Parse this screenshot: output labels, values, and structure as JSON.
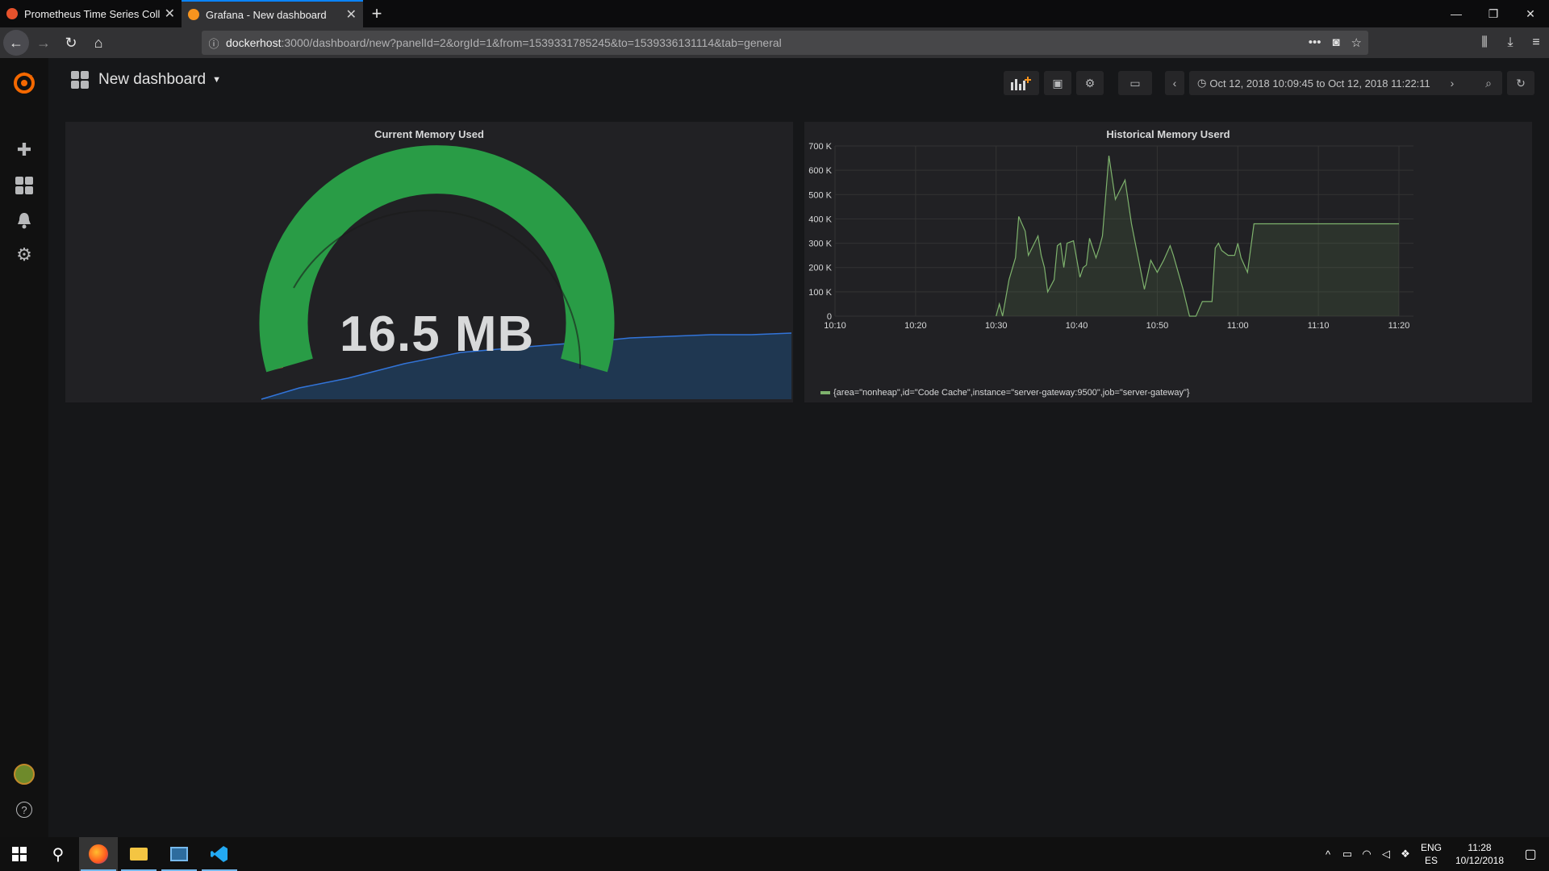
{
  "browser": {
    "tabs": [
      {
        "title": "Prometheus Time Series Collec",
        "color": "#e6522c",
        "active": false
      },
      {
        "title": "Grafana - New dashboard",
        "color": "#f7941e",
        "active": true
      }
    ],
    "url_host": "dockerhost",
    "url_path": ":3000/dashboard/new?panelId=2&orgId=1&from=1539331785245&to=1539336131114&tab=general"
  },
  "grafana": {
    "dashboard_title": "New dashboard",
    "time_range": "Oct 12, 2018 10:09:45 to Oct 12, 2018 11:22:11",
    "side_menu": [
      "grafana-logo",
      "create",
      "dashboards",
      "alerting",
      "configuration",
      "profile",
      "help"
    ]
  },
  "gauge_panel": {
    "title": "Current Memory Used",
    "value_text": "16.5 MB",
    "colors": {
      "ok": "#299c46",
      "critical": "#d44a3a",
      "spark": "#1f60c4"
    }
  },
  "graph_panel": {
    "title": "Historical Memory Userd",
    "legend": "{area=\"nonheap\",id=\"Code Cache\",instance=\"server-gateway:9500\",job=\"server-gateway\"}",
    "series_color": "#7eb26d"
  },
  "chart_data": {
    "type": "area",
    "title": "Historical Memory Userd",
    "x_ticks": [
      "10:10",
      "10:20",
      "10:30",
      "10:40",
      "10:50",
      "11:00",
      "11:10",
      "11:20"
    ],
    "y_ticks": [
      "0",
      "100 K",
      "200 K",
      "300 K",
      "400 K",
      "500 K",
      "600 K",
      "700 K"
    ],
    "ylim": [
      0,
      700000
    ],
    "series": [
      {
        "name": "{area=\"nonheap\",id=\"Code Cache\",instance=\"server-gateway:9500\",job=\"server-gateway\"}",
        "x_minutes": [
          10.0,
          10.5,
          11.0,
          12.0,
          13.0,
          13.5,
          14.5,
          15.0,
          16.5,
          17.0,
          17.5,
          18.0,
          19.0,
          19.5,
          20.0,
          20.5,
          21.0,
          22.0,
          23.0,
          23.5,
          24.0,
          24.5,
          25.5,
          26.0,
          26.5,
          27.5,
          28.5,
          30.0,
          31.0,
          33.0,
          34.0,
          35.0,
          36.0,
          37.0,
          37.5,
          39.0,
          40.0,
          41.0,
          42.0,
          42.5,
          43.5,
          44.0,
          44.5,
          45.0,
          46.0,
          47.0,
          47.5,
          48.0,
          49.0,
          50.0,
          51.0,
          51.5,
          53.0,
          54.0,
          55.0,
          55.5,
          56.0,
          57.0,
          58.0,
          59.0,
          60.0,
          61.0,
          62.0,
          63.0,
          64.0,
          65.0,
          66.5,
          68.0,
          69.5,
          70.5,
          71.5,
          72.5
        ],
        "values": [
          0,
          50000,
          0,
          150000,
          240000,
          410000,
          350000,
          250000,
          330000,
          250000,
          200000,
          100000,
          150000,
          290000,
          300000,
          200000,
          300000,
          310000,
          160000,
          200000,
          210000,
          320000,
          240000,
          280000,
          330000,
          660000,
          480000,
          560000,
          380000,
          110000,
          230000,
          180000,
          230000,
          290000,
          250000,
          110000,
          0,
          0,
          60000,
          60000,
          60000,
          280000,
          300000,
          270000,
          250000,
          250000,
          300000,
          240000,
          180000,
          380000,
          380000,
          380000,
          380000,
          380000,
          380000,
          380000,
          380000,
          380000,
          380000,
          380000,
          380000,
          380000,
          380000,
          380000,
          380000,
          380000,
          380000,
          380000,
          380000,
          380000,
          380000,
          380000
        ]
      }
    ]
  },
  "taskbar": {
    "lang": "ENG",
    "region": "ES",
    "time": "11:28",
    "date": "10/12/2018"
  }
}
